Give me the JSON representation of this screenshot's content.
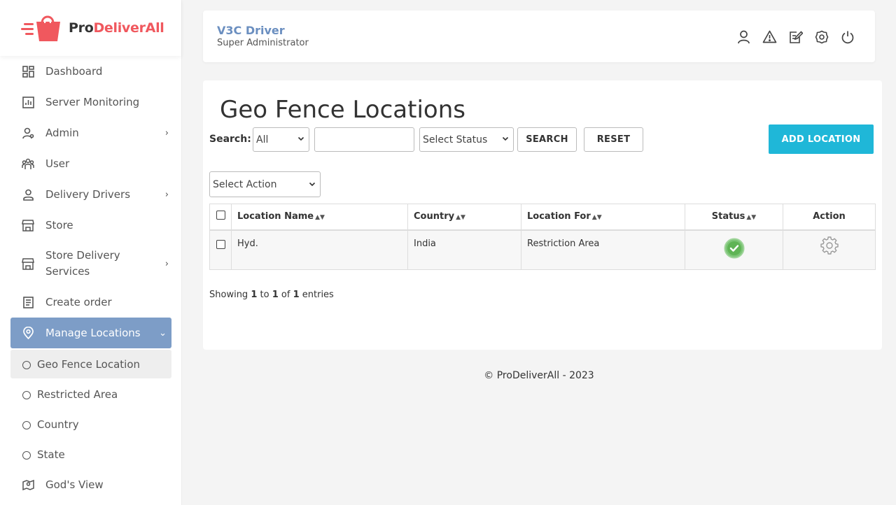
{
  "brand": {
    "logo_pro": "Pro",
    "logo_brand": "DeliverAll",
    "accent": "#f0585e"
  },
  "sidebar": {
    "items": [
      {
        "label": "Dashboard",
        "icon": "dashboard-icon"
      },
      {
        "label": "Server Monitoring",
        "icon": "chart-icon"
      },
      {
        "label": "Admin",
        "icon": "admin-icon",
        "has_children": true
      },
      {
        "label": "User",
        "icon": "users-icon"
      },
      {
        "label": "Delivery Drivers",
        "icon": "driver-icon",
        "has_children": true
      },
      {
        "label": "Store",
        "icon": "store-icon"
      },
      {
        "label": "Store Delivery Services",
        "line1": "Store Delivery",
        "line2": "Services",
        "icon": "store-icon",
        "has_children": true
      },
      {
        "label": "Create order",
        "icon": "order-icon"
      },
      {
        "label": "Manage Locations",
        "icon": "location-pin-icon",
        "active": true,
        "expanded": true
      },
      {
        "label": "God's View",
        "icon": "map-icon"
      }
    ],
    "sub_items": [
      {
        "label": "Geo Fence Location",
        "current": true
      },
      {
        "label": "Restricted Area"
      },
      {
        "label": "Country"
      },
      {
        "label": "State"
      }
    ],
    "active_color": "#7d9dc7"
  },
  "header": {
    "user_name": "V3C Driver",
    "user_role": "Super Administrator",
    "icons": [
      "user-icon",
      "warning-icon",
      "edit-icon",
      "settings-icon",
      "power-icon"
    ]
  },
  "main": {
    "title": "Geo Fence Locations",
    "search_label": "Search:",
    "search_field_select": "All",
    "search_input_value": "",
    "status_select": "Select Status",
    "search_button": "SEARCH",
    "reset_button": "RESET",
    "add_button": "ADD LOCATION",
    "action_select": "Select Action",
    "table": {
      "columns": [
        "Location Name",
        "Country",
        "Location For",
        "Status",
        "Action"
      ],
      "rows": [
        {
          "location_name": "Hyd.",
          "country": "India",
          "location_for": "Restriction Area",
          "status": "active"
        }
      ]
    },
    "showing": {
      "prefix": "Showing",
      "from": "1",
      "to_word": "to",
      "to": "1",
      "of_word": "of",
      "total": "1",
      "suffix": "entries"
    }
  },
  "footer": {
    "text": "© ProDeliverAll - 2023"
  }
}
